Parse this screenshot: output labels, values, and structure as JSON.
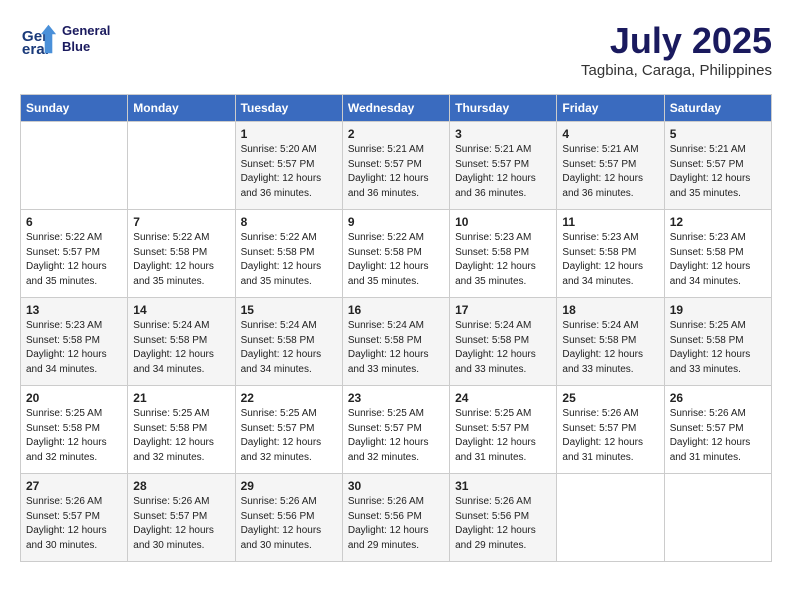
{
  "header": {
    "logo_line1": "General",
    "logo_line2": "Blue",
    "title": "July 2025",
    "location": "Tagbina, Caraga, Philippines"
  },
  "days_of_week": [
    "Sunday",
    "Monday",
    "Tuesday",
    "Wednesday",
    "Thursday",
    "Friday",
    "Saturday"
  ],
  "weeks": [
    [
      {
        "day": "",
        "info": ""
      },
      {
        "day": "",
        "info": ""
      },
      {
        "day": "1",
        "info": "Sunrise: 5:20 AM\nSunset: 5:57 PM\nDaylight: 12 hours and 36 minutes."
      },
      {
        "day": "2",
        "info": "Sunrise: 5:21 AM\nSunset: 5:57 PM\nDaylight: 12 hours and 36 minutes."
      },
      {
        "day": "3",
        "info": "Sunrise: 5:21 AM\nSunset: 5:57 PM\nDaylight: 12 hours and 36 minutes."
      },
      {
        "day": "4",
        "info": "Sunrise: 5:21 AM\nSunset: 5:57 PM\nDaylight: 12 hours and 36 minutes."
      },
      {
        "day": "5",
        "info": "Sunrise: 5:21 AM\nSunset: 5:57 PM\nDaylight: 12 hours and 35 minutes."
      }
    ],
    [
      {
        "day": "6",
        "info": "Sunrise: 5:22 AM\nSunset: 5:57 PM\nDaylight: 12 hours and 35 minutes."
      },
      {
        "day": "7",
        "info": "Sunrise: 5:22 AM\nSunset: 5:58 PM\nDaylight: 12 hours and 35 minutes."
      },
      {
        "day": "8",
        "info": "Sunrise: 5:22 AM\nSunset: 5:58 PM\nDaylight: 12 hours and 35 minutes."
      },
      {
        "day": "9",
        "info": "Sunrise: 5:22 AM\nSunset: 5:58 PM\nDaylight: 12 hours and 35 minutes."
      },
      {
        "day": "10",
        "info": "Sunrise: 5:23 AM\nSunset: 5:58 PM\nDaylight: 12 hours and 35 minutes."
      },
      {
        "day": "11",
        "info": "Sunrise: 5:23 AM\nSunset: 5:58 PM\nDaylight: 12 hours and 34 minutes."
      },
      {
        "day": "12",
        "info": "Sunrise: 5:23 AM\nSunset: 5:58 PM\nDaylight: 12 hours and 34 minutes."
      }
    ],
    [
      {
        "day": "13",
        "info": "Sunrise: 5:23 AM\nSunset: 5:58 PM\nDaylight: 12 hours and 34 minutes."
      },
      {
        "day": "14",
        "info": "Sunrise: 5:24 AM\nSunset: 5:58 PM\nDaylight: 12 hours and 34 minutes."
      },
      {
        "day": "15",
        "info": "Sunrise: 5:24 AM\nSunset: 5:58 PM\nDaylight: 12 hours and 34 minutes."
      },
      {
        "day": "16",
        "info": "Sunrise: 5:24 AM\nSunset: 5:58 PM\nDaylight: 12 hours and 33 minutes."
      },
      {
        "day": "17",
        "info": "Sunrise: 5:24 AM\nSunset: 5:58 PM\nDaylight: 12 hours and 33 minutes."
      },
      {
        "day": "18",
        "info": "Sunrise: 5:24 AM\nSunset: 5:58 PM\nDaylight: 12 hours and 33 minutes."
      },
      {
        "day": "19",
        "info": "Sunrise: 5:25 AM\nSunset: 5:58 PM\nDaylight: 12 hours and 33 minutes."
      }
    ],
    [
      {
        "day": "20",
        "info": "Sunrise: 5:25 AM\nSunset: 5:58 PM\nDaylight: 12 hours and 32 minutes."
      },
      {
        "day": "21",
        "info": "Sunrise: 5:25 AM\nSunset: 5:58 PM\nDaylight: 12 hours and 32 minutes."
      },
      {
        "day": "22",
        "info": "Sunrise: 5:25 AM\nSunset: 5:57 PM\nDaylight: 12 hours and 32 minutes."
      },
      {
        "day": "23",
        "info": "Sunrise: 5:25 AM\nSunset: 5:57 PM\nDaylight: 12 hours and 32 minutes."
      },
      {
        "day": "24",
        "info": "Sunrise: 5:25 AM\nSunset: 5:57 PM\nDaylight: 12 hours and 31 minutes."
      },
      {
        "day": "25",
        "info": "Sunrise: 5:26 AM\nSunset: 5:57 PM\nDaylight: 12 hours and 31 minutes."
      },
      {
        "day": "26",
        "info": "Sunrise: 5:26 AM\nSunset: 5:57 PM\nDaylight: 12 hours and 31 minutes."
      }
    ],
    [
      {
        "day": "27",
        "info": "Sunrise: 5:26 AM\nSunset: 5:57 PM\nDaylight: 12 hours and 30 minutes."
      },
      {
        "day": "28",
        "info": "Sunrise: 5:26 AM\nSunset: 5:57 PM\nDaylight: 12 hours and 30 minutes."
      },
      {
        "day": "29",
        "info": "Sunrise: 5:26 AM\nSunset: 5:56 PM\nDaylight: 12 hours and 30 minutes."
      },
      {
        "day": "30",
        "info": "Sunrise: 5:26 AM\nSunset: 5:56 PM\nDaylight: 12 hours and 29 minutes."
      },
      {
        "day": "31",
        "info": "Sunrise: 5:26 AM\nSunset: 5:56 PM\nDaylight: 12 hours and 29 minutes."
      },
      {
        "day": "",
        "info": ""
      },
      {
        "day": "",
        "info": ""
      }
    ]
  ]
}
